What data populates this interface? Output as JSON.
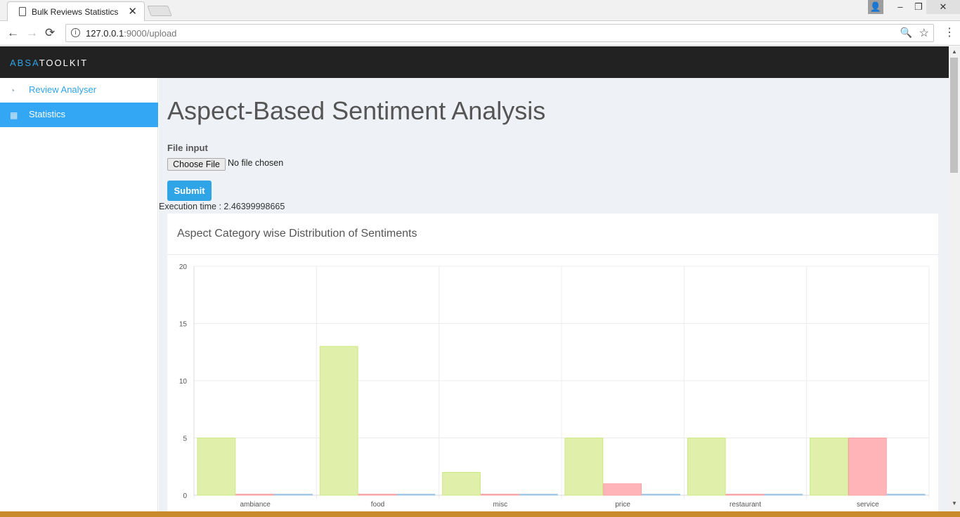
{
  "browser": {
    "tab_title": "Bulk Reviews Statistics",
    "tab_close": "✕",
    "url_host": "127.0.0.1",
    "url_path": ":9000/upload",
    "win_profile": "👤",
    "win_min": "–",
    "win_max": "❐",
    "win_close": "✕",
    "back": "←",
    "forward": "→",
    "reload": "⟳",
    "info": "i",
    "zoom": "🔍",
    "star": "☆",
    "menu": "⋮"
  },
  "app": {
    "brand_a": "ABSA",
    "brand_b": "TOOLKIT"
  },
  "sidebar": {
    "items": [
      {
        "label": "Review Analyser",
        "icon": "dashboard-icon",
        "glyph": "◔"
      },
      {
        "label": "Statistics",
        "icon": "calendar-icon",
        "glyph": "▦"
      }
    ]
  },
  "main": {
    "title": "Aspect-Based Sentiment Analysis",
    "file_label": "File input",
    "choose_file": "Choose File",
    "no_file": "No file chosen",
    "submit": "Submit",
    "execution": "Execution time : 2.46399998665",
    "panel_title": "Aspect Category wise Distribution of Sentiments"
  },
  "colors": {
    "accent": "#2fa4e7",
    "positive_fill": "#e0f0aa",
    "positive_stroke": "#cde882",
    "negative_fill": "#ffb5b8",
    "negative_stroke": "#f7a1a5",
    "neutral_fill": "#b5d6ee",
    "neutral_stroke": "#9cc4e4"
  },
  "chart_data": {
    "type": "bar",
    "categories": [
      "ambiance",
      "food",
      "misc",
      "price",
      "restaurant",
      "service"
    ],
    "series": [
      {
        "values": [
          5,
          13,
          2,
          5,
          5,
          5
        ]
      },
      {
        "values": [
          0,
          0,
          0,
          1,
          0,
          5
        ]
      },
      {
        "values": [
          0,
          0,
          0,
          0,
          0,
          0
        ]
      }
    ],
    "yticks": [
      "20",
      "15",
      "10",
      "5",
      "0"
    ],
    "ylim": [
      0,
      20
    ],
    "grid": true
  }
}
